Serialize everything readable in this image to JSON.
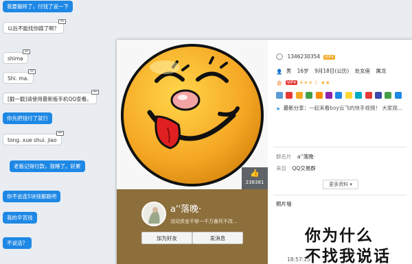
{
  "chat": {
    "messages": [
      {
        "text": "我要搬砖了，付钱了说一下",
        "style": "blue"
      },
      {
        "text": "以后不能找你蹭了啊？",
        "style": "white"
      },
      {
        "text": "shima",
        "style": "white"
      },
      {
        "text": "Shi.  ma.",
        "style": "white"
      },
      {
        "text": "[戳一戳]请使用最新版手机QQ查看。",
        "style": "white"
      },
      {
        "text": "你先把钱付了就行",
        "style": "blue"
      },
      {
        "text": "tong.  xue shui.  jiao",
        "style": "white"
      },
      {
        "text": "老板记得付款，我睡了。好累",
        "style": "blue"
      },
      {
        "text": "你不会连5块钱都跑吧",
        "style": "blue"
      },
      {
        "text": "我的辛苦钱",
        "style": "blue"
      },
      {
        "text": "不说话？",
        "style": "blue"
      }
    ]
  },
  "profile": {
    "qq_number": "1346230354",
    "gender": "男",
    "age": "16岁",
    "birthday": "9月18日(公历)",
    "zodiac": "处女座",
    "chinese_zodiac": "属龙",
    "vip_badge": "VIP4",
    "latest_share_label": "最新分享：",
    "latest_share": "一起来看boy云飞的快手视频！ 大家观...",
    "like_count": "238381",
    "nickname": "a''落晚·",
    "signature": "流动资金不够一千万番死不改...",
    "add_friend_label": "加为好友",
    "send_message_label": "发消息",
    "group_card_label": "群名片",
    "group_card_value": "a''落晚·",
    "from_label": "来自",
    "from_value": "QQ交易群",
    "more_label": "更多资料",
    "photo_wall_label": "照片墙",
    "photo_wall_text_1": "你为什么",
    "photo_wall_text_2": "不找我说话"
  },
  "footer": {
    "time": "18:57:15"
  },
  "colors": {
    "bubble_blue": "#1e88e5",
    "card_brown": "#8d6f3c",
    "emoji_yellow": "#f5a623"
  },
  "icons": [
    "qq-icon",
    "person-icon",
    "cake-icon",
    "share-icon",
    "thumb-up-icon",
    "sun-icon",
    "moon-icon",
    "star-icon",
    "crown-icon"
  ]
}
